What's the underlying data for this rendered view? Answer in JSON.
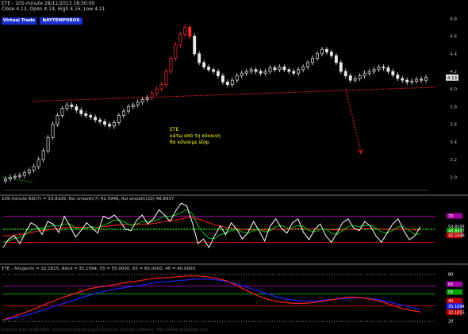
{
  "colors": {
    "background": "#000000",
    "grid": "#404040",
    "candle_up": "#e8e8e8",
    "candle_down": "#e8e8e8",
    "candle_hot": "#ff2a2a",
    "trendline": "#ff2020",
    "arrow": "#ff2020",
    "annotation": "#ffff00",
    "rsi_line": "#ffffff",
    "rsi_smooth7": "#00c000",
    "rsi_smooth20": "#ff2020",
    "midline": "#20ff20",
    "stoch_k": "#ff2020",
    "stoch_d": "#2020ff",
    "button_bg": "#1a2fd0"
  },
  "header": {
    "line1": "ETE - 105-minute 28/11/2013 18:30:00",
    "line2": "Close 4.13, Open 4.14, High 4.16, Low 4.11"
  },
  "buttons": [
    "Virtual Trade",
    "NAYTEMPOROS"
  ],
  "annotation": [
    "ETE",
    "κάτω από τη κόκκινη",
    "θα κάνουμε stop"
  ],
  "footer": "Created with AmiBroker - advanced charting and technical analysis software. http://www.amibroker.com",
  "chart_data": [
    {
      "type": "candlestick",
      "title": "ETE - 105-minute 28/11/2013 18:30:00",
      "ylim": [
        2.85,
        4.92
      ],
      "y_ticks": [
        3.0,
        3.2,
        3.4,
        3.6,
        3.8,
        4.0,
        4.2,
        4.4,
        4.6,
        4.8
      ],
      "last_value_label": "4.13",
      "close": [
        2.98,
        3.0,
        3.01,
        3.02,
        3.05,
        3.08,
        3.12,
        3.2,
        3.3,
        3.45,
        3.6,
        3.7,
        3.78,
        3.82,
        3.8,
        3.76,
        3.72,
        3.7,
        3.68,
        3.65,
        3.63,
        3.6,
        3.58,
        3.62,
        3.7,
        3.75,
        3.8,
        3.82,
        3.85,
        3.88,
        3.9,
        3.95,
        4.0,
        4.05,
        4.2,
        4.35,
        4.5,
        4.62,
        4.7,
        4.6,
        4.4,
        4.3,
        4.25,
        4.22,
        4.2,
        4.15,
        4.08,
        4.05,
        4.1,
        4.15,
        4.18,
        4.2,
        4.22,
        4.2,
        4.18,
        4.2,
        4.24,
        4.22,
        4.25,
        4.22,
        4.2,
        4.18,
        4.22,
        4.25,
        4.3,
        4.35,
        4.4,
        4.45,
        4.42,
        4.38,
        4.3,
        4.2,
        4.15,
        4.1,
        4.12,
        4.15,
        4.18,
        4.2,
        4.22,
        4.25,
        4.24,
        4.2,
        4.16,
        4.12,
        4.1,
        4.08,
        4.09,
        4.11,
        4.1,
        4.13
      ]
    },
    {
      "type": "line",
      "title": "105-minute RSI(7) = 53.8105, Rsi smooth(7) 42.5948, Rsi smooth(20) 48.8937",
      "ylim": [
        0,
        100
      ],
      "levels": [
        30,
        50,
        70
      ],
      "value_labels": [
        "70",
        "53.8105",
        "48.8937",
        "42.5948"
      ],
      "series": [
        {
          "name": "RSI(7)",
          "values": [
            22,
            35,
            40,
            28,
            45,
            60,
            55,
            42,
            62,
            58,
            45,
            70,
            55,
            38,
            48,
            60,
            52,
            44,
            70,
            66,
            72,
            62,
            50,
            48,
            64,
            72,
            58,
            66,
            80,
            72,
            62,
            78,
            90,
            86,
            60,
            28,
            35,
            22,
            40,
            55,
            42,
            60,
            50,
            35,
            45,
            62,
            48,
            32,
            55,
            66,
            52,
            44,
            60,
            66,
            45,
            34,
            50,
            58,
            40,
            30,
            44,
            60,
            66,
            52,
            48,
            62,
            55,
            40,
            30,
            44,
            58,
            66,
            48,
            34,
            40,
            54
          ]
        },
        {
          "name": "Rsi smooth(7)",
          "values": [
            30,
            32,
            36,
            38,
            42,
            48,
            52,
            52,
            54,
            56,
            55,
            58,
            58,
            52,
            50,
            52,
            54,
            52,
            56,
            60,
            64,
            64,
            60,
            56,
            58,
            62,
            62,
            62,
            66,
            70,
            70,
            72,
            76,
            80,
            74,
            56,
            44,
            36,
            36,
            42,
            44,
            48,
            50,
            46,
            44,
            48,
            50,
            46,
            48,
            54,
            56,
            52,
            52,
            56,
            54,
            48,
            46,
            50,
            50,
            44,
            42,
            48,
            54,
            56,
            54,
            56,
            56,
            52,
            46,
            44,
            48,
            54,
            54,
            48,
            42,
            43
          ]
        },
        {
          "name": "Rsi smooth(20)",
          "values": [
            40,
            40,
            41,
            42,
            43,
            45,
            47,
            48,
            49,
            50,
            51,
            52,
            53,
            53,
            53,
            53,
            53,
            53,
            54,
            55,
            56,
            57,
            57,
            57,
            57,
            58,
            58,
            59,
            60,
            62,
            63,
            64,
            66,
            68,
            68,
            66,
            63,
            60,
            57,
            55,
            53,
            52,
            51,
            50,
            49,
            49,
            49,
            49,
            49,
            50,
            50,
            50,
            50,
            51,
            51,
            50,
            50,
            50,
            50,
            49,
            49,
            49,
            50,
            50,
            50,
            51,
            51,
            51,
            50,
            50,
            50,
            50,
            50,
            50,
            49,
            49
          ]
        }
      ]
    },
    {
      "type": "line",
      "title": "ETE - Allvgents = 32.1815, Allvd = 35.1094, 55 = 55.0000, 65 = 65.0000, 40 = 40.0000",
      "ylim": [
        15,
        90
      ],
      "levels": [
        20,
        40,
        55,
        65,
        80
      ],
      "value_labels": [
        "80",
        "65",
        "55",
        "40",
        "35.1094",
        "32.1815",
        "20"
      ],
      "series": [
        {
          "name": "K",
          "values": [
            22,
            26,
            30,
            35,
            40,
            45,
            50,
            54,
            58,
            62,
            64,
            66,
            68,
            70,
            72,
            74,
            75,
            76,
            77,
            78,
            78,
            77,
            75,
            72,
            66,
            60,
            54,
            49,
            46,
            44,
            43,
            43,
            44,
            46,
            48,
            50,
            51,
            50,
            48,
            45,
            41,
            37,
            34,
            32
          ]
        },
        {
          "name": "D",
          "values": [
            22,
            24,
            27,
            30,
            34,
            38,
            42,
            46,
            50,
            54,
            57,
            60,
            62,
            64,
            66,
            68,
            70,
            71,
            72,
            73,
            74,
            74,
            73,
            71,
            68,
            64,
            60,
            56,
            52,
            49,
            47,
            46,
            46,
            47,
            48,
            49,
            50,
            50,
            49,
            47,
            44,
            41,
            38,
            35
          ]
        }
      ]
    }
  ]
}
